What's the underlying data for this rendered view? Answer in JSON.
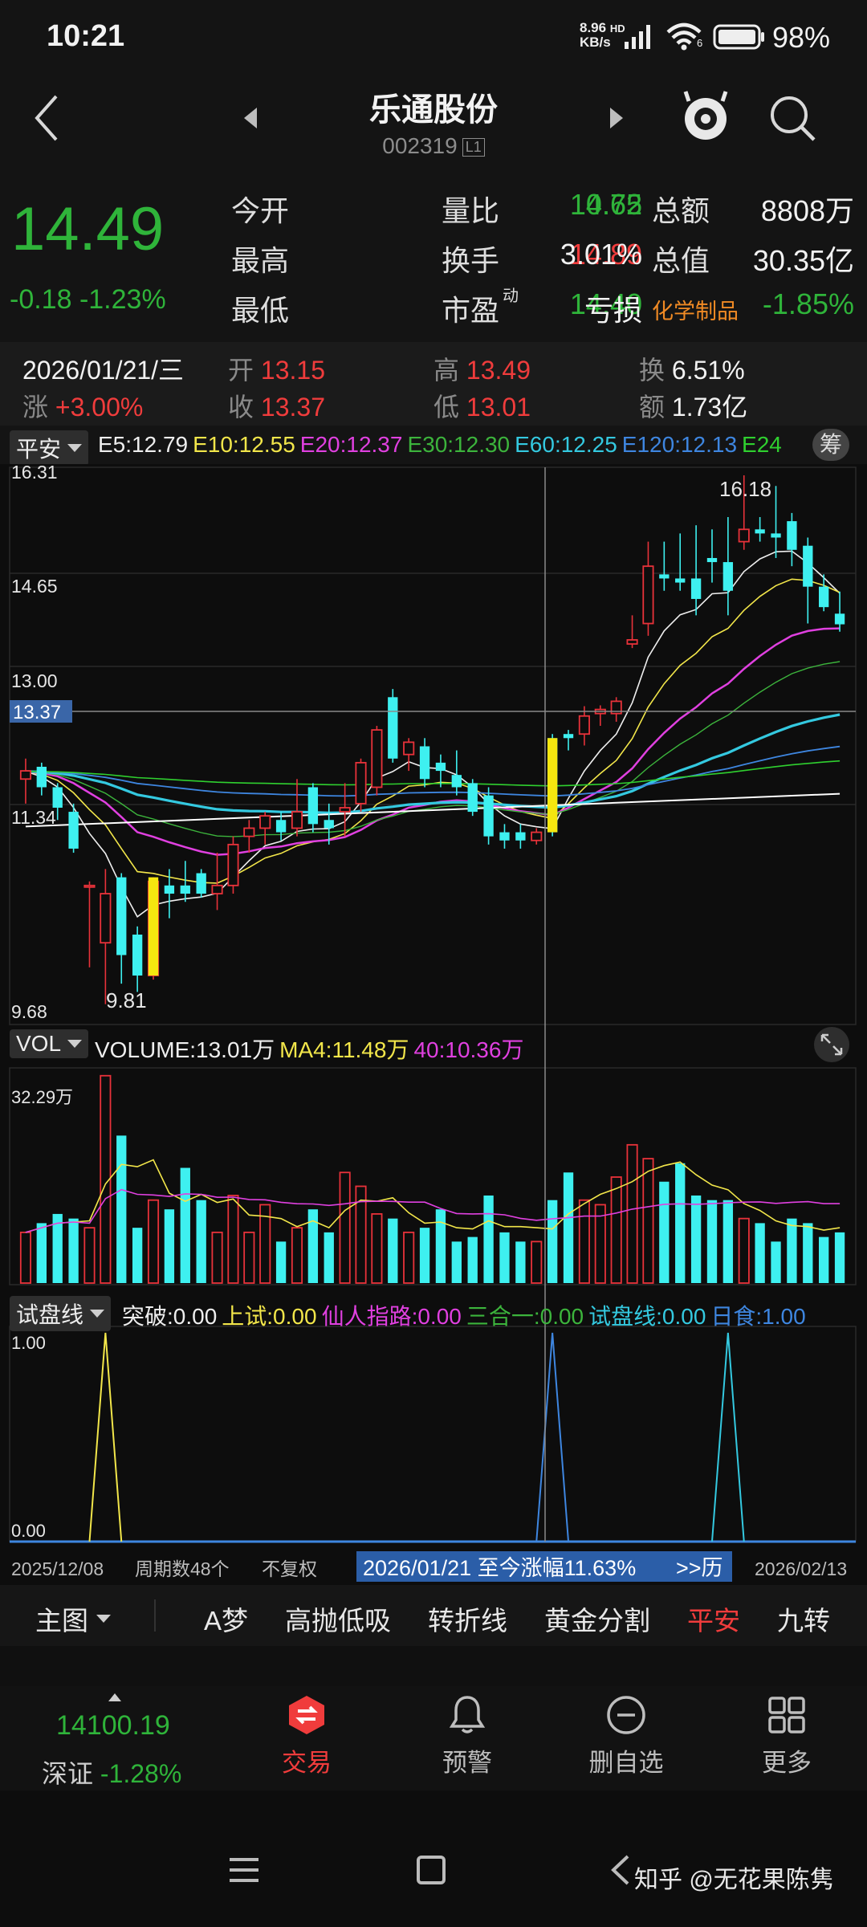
{
  "status_bar": {
    "time": "10:21",
    "net_speed": "8.96",
    "net_unit": "KB/s",
    "hd_label": "HD",
    "wifi_sub": "6",
    "battery": "98%"
  },
  "nav": {
    "title": "乐通股份",
    "code": "002319",
    "code_badge": "L1"
  },
  "quote": {
    "price": "14.49",
    "change": "-0.18",
    "change_pct": "-1.23%",
    "rows": [
      [
        {
          "label": "今开",
          "value": "14.62",
          "color": "green"
        },
        {
          "label": "量比",
          "value": "0.75",
          "color": "green"
        },
        {
          "label": "总额",
          "value": "8808万",
          "color": "white"
        }
      ],
      [
        {
          "label": "最高",
          "value": "14.89",
          "color": "red"
        },
        {
          "label": "换手",
          "value": "3.01%",
          "color": "white"
        },
        {
          "label": "总值",
          "value": "30.35亿",
          "color": "white"
        }
      ],
      [
        {
          "label": "最低",
          "value": "14.40",
          "color": "green"
        },
        {
          "label": "市盈",
          "sup": "动",
          "value": "亏损",
          "color": "white"
        },
        {
          "label": "化学制品",
          "value": "-1.85%",
          "color": "green"
        }
      ]
    ]
  },
  "day_info": {
    "date": "2026/01/21/三",
    "rise_label": "涨",
    "rise": "+3.00%",
    "open_label": "开",
    "open": "13.15",
    "close_label": "收",
    "close": "13.37",
    "high_label": "高",
    "high": "13.49",
    "low_label": "低",
    "low": "13.01",
    "turnover_label": "换",
    "turnover": "6.51%",
    "amount_label": "额",
    "amount": "1.73亿"
  },
  "main_chart": {
    "selector": "平安",
    "ma_labels": [
      {
        "text": "E5:12.79",
        "color": "#eeeeee"
      },
      {
        "text": "E10:12.55",
        "color": "#f2e64a"
      },
      {
        "text": "E20:12.37",
        "color": "#e040e0"
      },
      {
        "text": "E30:12.30",
        "color": "#3cb43c"
      },
      {
        "text": "E60:12.25",
        "color": "#34c9e0"
      },
      {
        "text": "E120:12.13",
        "color": "#3e86e0"
      },
      {
        "text": "E24",
        "color": "#2fd02f"
      }
    ],
    "chip_button": "筹",
    "y_labels": [
      "16.31",
      "14.65",
      "13.00",
      "11.34",
      "9.68"
    ],
    "crosshair_value": "13.37",
    "max_label": "16.18",
    "min_label": "9.81"
  },
  "volume_chart": {
    "selector": "VOL",
    "labels": [
      {
        "text": "VOLUME:13.01万",
        "color": "#eeeeee"
      },
      {
        "text": "MA4:11.48万",
        "color": "#f2e64a"
      },
      {
        "text": "40:10.36万",
        "color": "#e040e0"
      }
    ],
    "y_max": "32.29万"
  },
  "indicator_chart": {
    "selector": "试盘线",
    "labels": [
      {
        "text": "突破:0.00",
        "color": "#eeeeee"
      },
      {
        "text": "上试:0.00",
        "color": "#f2e64a"
      },
      {
        "text": "仙人指路:0.00",
        "color": "#e040e0"
      },
      {
        "text": "三合一:0.00",
        "color": "#3cb43c"
      },
      {
        "text": "试盘线:0.00",
        "color": "#34c9e0"
      },
      {
        "text": "日食:1.00",
        "color": "#3e86e0"
      }
    ],
    "y_top": "1.00",
    "y_bottom": "0.00"
  },
  "time_axis": {
    "start": "2025/12/08",
    "period": "周期数48个",
    "adjust": "不复权",
    "range_text": "2026/01/21 至今涨幅11.63%",
    "history_button": ">>历",
    "end": "2026/02/13"
  },
  "bottom_tabs": {
    "main_selector": "主图",
    "items": [
      "A梦",
      "高抛低吸",
      "转折线",
      "黄金分割",
      "平安",
      "九转"
    ],
    "active": "平安"
  },
  "dock": {
    "index_value": "14100.19",
    "index_name": "深证",
    "index_change": "-1.28%",
    "items": [
      {
        "label": "交易",
        "icon": "trade-icon",
        "active": true
      },
      {
        "label": "预警",
        "icon": "bell-icon",
        "active": false
      },
      {
        "label": "删自选",
        "icon": "minus-circle-icon",
        "active": false
      },
      {
        "label": "更多",
        "icon": "grid-icon",
        "active": false
      }
    ]
  },
  "watermark": "知乎 @无花果陈隽",
  "chart_data": {
    "type": "candlestick",
    "title": "",
    "ylim": [
      9.68,
      16.31
    ],
    "candles_ohlc": [
      [
        12.6,
        12.85,
        12.3,
        12.7
      ],
      [
        12.75,
        12.8,
        12.4,
        12.5
      ],
      [
        12.5,
        12.55,
        12.1,
        12.25
      ],
      [
        12.2,
        12.3,
        11.7,
        11.75
      ],
      [
        11.3,
        11.35,
        10.3,
        11.3
      ],
      [
        10.6,
        11.5,
        9.85,
        11.2
      ],
      [
        11.4,
        11.45,
        10.1,
        10.45
      ],
      [
        10.7,
        10.8,
        10.0,
        10.2
      ],
      [
        10.2,
        11.4,
        10.15,
        11.35
      ],
      [
        11.3,
        11.5,
        10.9,
        11.2
      ],
      [
        11.3,
        11.6,
        11.1,
        11.2
      ],
      [
        11.45,
        11.5,
        11.15,
        11.2
      ],
      [
        11.2,
        11.7,
        11.0,
        11.3
      ],
      [
        11.3,
        11.9,
        11.2,
        11.8
      ],
      [
        11.9,
        12.1,
        11.7,
        12.0
      ],
      [
        12.0,
        12.2,
        11.8,
        12.15
      ],
      [
        12.1,
        12.2,
        11.85,
        11.95
      ],
      [
        12.0,
        12.6,
        11.9,
        12.2
      ],
      [
        12.5,
        12.55,
        11.95,
        12.05
      ],
      [
        12.1,
        12.3,
        11.8,
        12.0
      ],
      [
        12.2,
        12.55,
        11.9,
        12.25
      ],
      [
        12.3,
        12.85,
        12.2,
        12.8
      ],
      [
        12.5,
        13.25,
        12.4,
        13.2
      ],
      [
        13.6,
        13.7,
        12.8,
        12.85
      ],
      [
        12.9,
        13.1,
        12.7,
        13.05
      ],
      [
        13.0,
        13.1,
        12.5,
        12.6
      ],
      [
        12.8,
        12.9,
        12.5,
        12.7
      ],
      [
        12.65,
        12.95,
        12.4,
        12.5
      ],
      [
        12.55,
        12.6,
        12.15,
        12.2
      ],
      [
        12.4,
        12.5,
        11.8,
        11.9
      ],
      [
        11.95,
        12.05,
        11.75,
        11.85
      ],
      [
        11.95,
        12.05,
        11.75,
        11.85
      ],
      [
        11.85,
        12.0,
        11.8,
        11.95
      ],
      [
        13.1,
        13.15,
        11.9,
        11.95
      ],
      [
        13.15,
        13.2,
        12.95,
        13.1
      ],
      [
        13.15,
        13.49,
        13.01,
        13.37
      ],
      [
        13.4,
        13.5,
        13.25,
        13.45
      ],
      [
        13.4,
        13.6,
        13.3,
        13.55
      ],
      [
        14.25,
        14.6,
        14.2,
        14.3
      ],
      [
        14.5,
        15.5,
        14.35,
        15.2
      ],
      [
        15.1,
        15.5,
        14.9,
        15.05
      ],
      [
        15.05,
        15.6,
        14.9,
        15.0
      ],
      [
        15.05,
        15.7,
        14.6,
        14.8
      ],
      [
        15.3,
        15.65,
        15.0,
        15.25
      ],
      [
        15.25,
        15.8,
        14.6,
        14.9
      ],
      [
        15.5,
        16.31,
        15.4,
        15.65
      ],
      [
        15.65,
        15.8,
        15.5,
        15.6
      ],
      [
        15.6,
        16.18,
        15.3,
        15.55
      ],
      [
        15.75,
        15.85,
        15.2,
        15.4
      ],
      [
        15.45,
        15.55,
        14.5,
        14.95
      ],
      [
        14.95,
        15.1,
        14.65,
        14.7
      ],
      [
        14.62,
        14.89,
        14.4,
        14.49
      ]
    ],
    "volume": [
      11,
      13,
      15,
      14,
      12,
      45,
      32,
      12,
      18,
      16,
      25,
      18,
      11,
      19,
      11,
      17,
      9,
      12,
      16,
      11,
      24,
      21,
      15,
      14,
      11,
      12,
      16,
      9,
      10,
      19,
      11,
      9,
      9,
      18,
      24,
      18,
      17,
      23,
      30,
      27,
      22,
      26,
      19,
      18,
      18,
      14,
      13,
      9,
      14,
      13,
      10,
      11
    ]
  }
}
